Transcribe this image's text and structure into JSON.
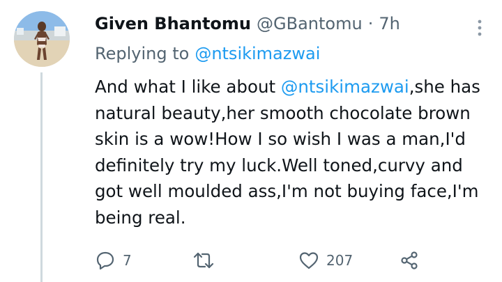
{
  "tweet": {
    "display_name": "Given Bhantomu",
    "handle": "@GBantomu",
    "separator": "·",
    "time": "7h",
    "replying_prefix": "Replying to",
    "replying_to": "@ntsikimazwai",
    "body_before": "And what I like about ",
    "body_mention": "@ntsikimazwai",
    "body_after": ",she has natural beauty,her smooth chocolate brown skin is a wow!How I so wish I was a man,I'd definitely try my luck.Well toned,curvy and got well moulded ass,I'm not buying face,I'm being real."
  },
  "actions": {
    "reply_count": "7",
    "retweet_count": "",
    "like_count": "207"
  },
  "icons": {
    "avatar": "avatar",
    "more": "more-vertical-icon",
    "reply": "reply-icon",
    "retweet": "retweet-icon",
    "like": "heart-icon",
    "share": "share-icon"
  },
  "colors": {
    "text": "#0f1419",
    "secondary": "#536471",
    "link": "#1d9bf0",
    "thread_line": "#cfd9de"
  }
}
